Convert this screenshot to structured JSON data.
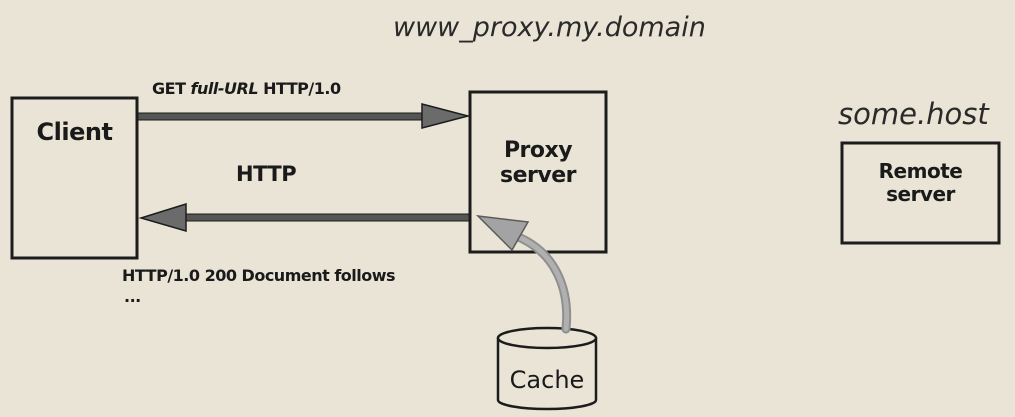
{
  "proxy_host": "www_proxy.my.domain",
  "remote_host": "some.host",
  "client_label": "Client",
  "proxy_label_line1": "Proxy",
  "proxy_label_line2": "server",
  "remote_label_line1": "Remote",
  "remote_label_line2": "server",
  "cache_label": "Cache",
  "request": {
    "prefix": "GET ",
    "url_token": "full-URL",
    "suffix": " HTTP/1.0"
  },
  "protocol_label": "HTTP",
  "response_line": "HTTP/1.0 200 Document follows",
  "response_more": "...",
  "colors": {
    "background": "#e9e4d6",
    "ink": "#1c1c1c",
    "arrow_fill": "#6b6b6b",
    "cache_arrow": "#9a9a9a"
  }
}
